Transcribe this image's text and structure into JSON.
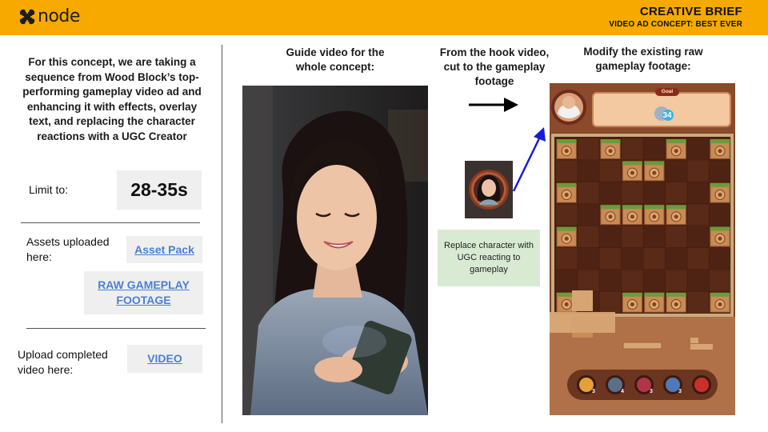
{
  "header": {
    "logo_text": "node",
    "title": "CREATIVE BRIEF",
    "subtitle": "VIDEO AD CONCEPT: BEST EVER",
    "bar_color": "#f7a900"
  },
  "left_panel": {
    "intro": "For this concept, we are taking a sequence from Wood Block’s top-performing gameplay video ad and enhancing it with effects, overlay text, and replacing the character reactions with a UGC Creator",
    "limit_label": "Limit to:",
    "limit_value": "28-35s",
    "assets_label": "Assets uploaded here:",
    "asset_pack_link": "Asset Pack",
    "raw_gameplay_link": "RAW GAMEPLAY FOOTAGE",
    "upload_label": "Upload completed video here:",
    "video_link": "VIDEO",
    "link_color": "#4a7fd6"
  },
  "columns": {
    "guide_title": "Guide video for the whole concept:",
    "hook_title": "From the hook video, cut to the gameplay footage",
    "modify_title": "Modify the existing raw gameplay footage:"
  },
  "annotation": {
    "note": "Replace character with UGC reacting to gameplay",
    "note_color": "#d9ead3",
    "arrow_color": "#1a1adb"
  },
  "game": {
    "goal_label": "Goal",
    "goal_count": "34",
    "booster_counts": [
      "3",
      "4",
      "3",
      "3"
    ],
    "booster_icons": [
      "magnet-icon",
      "bomb-icon",
      "rocket-icon",
      "vortex-icon",
      "settings-icon"
    ]
  }
}
